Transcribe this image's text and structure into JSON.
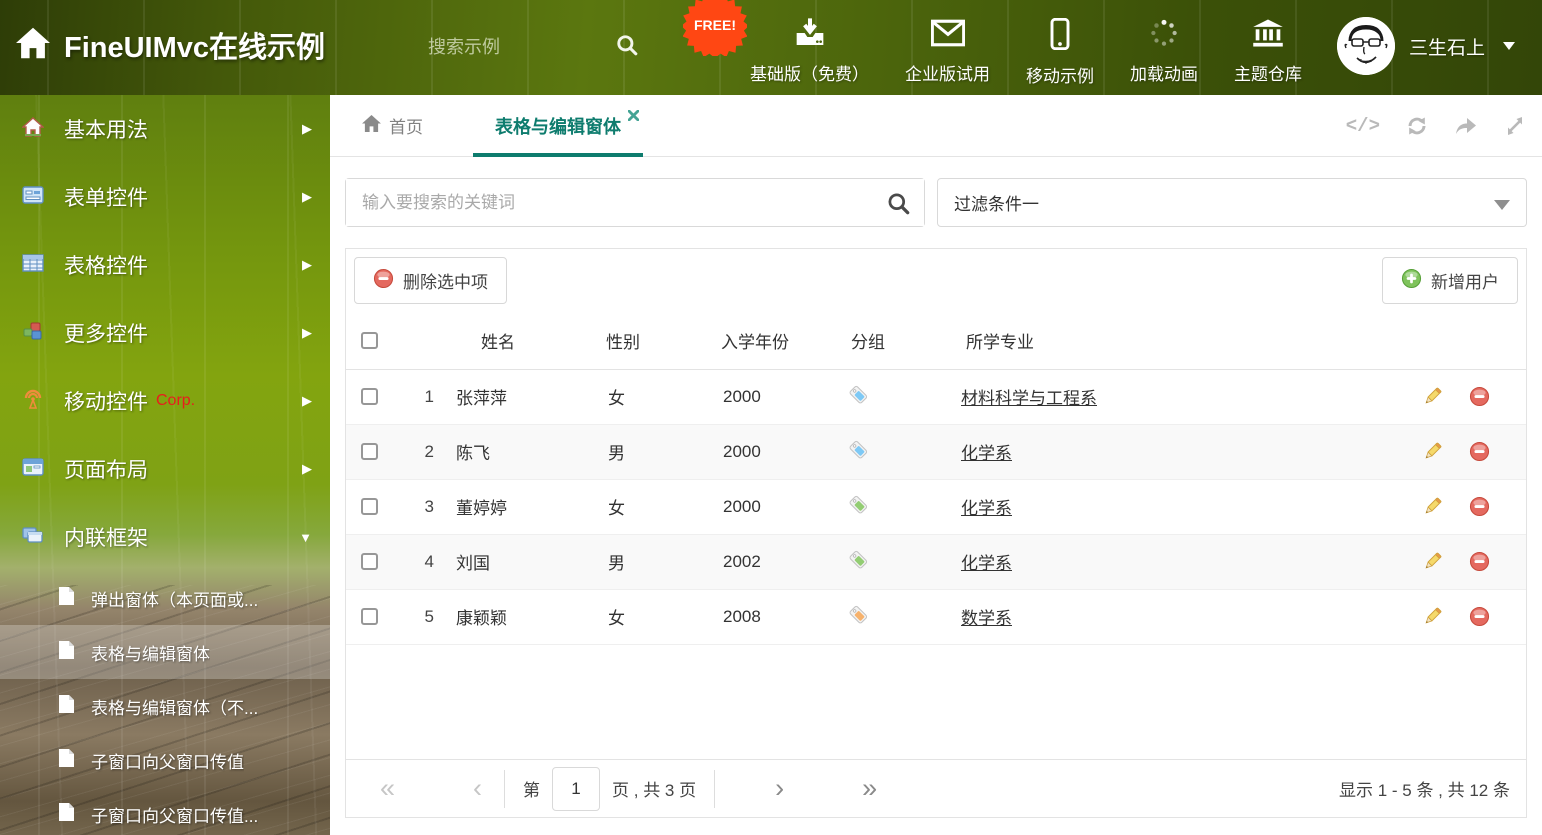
{
  "header": {
    "title": "FineUIMvc在线示例",
    "search_placeholder": "搜索示例",
    "free_badge": "FREE!",
    "nav": [
      {
        "label": "基础版（免费）",
        "icon": "download-icon"
      },
      {
        "label": "企业版试用",
        "icon": "envelope-icon"
      },
      {
        "label": "移动示例",
        "icon": "mobile-icon"
      },
      {
        "label": "加载动画",
        "icon": "spinner-icon"
      },
      {
        "label": "主题仓库",
        "icon": "bank-icon"
      }
    ],
    "user": {
      "name": "三生石上"
    }
  },
  "sidebar": {
    "items": [
      {
        "label": "基本用法"
      },
      {
        "label": "表单控件"
      },
      {
        "label": "表格控件"
      },
      {
        "label": "更多控件"
      },
      {
        "label": "移动控件",
        "badge": "Corp."
      },
      {
        "label": "页面布局"
      },
      {
        "label": "内联框架"
      }
    ],
    "subitems": [
      {
        "label": "弹出窗体（本页面或..."
      },
      {
        "label": "表格与编辑窗体"
      },
      {
        "label": "表格与编辑窗体（不..."
      },
      {
        "label": "子窗口向父窗口传值"
      },
      {
        "label": "子窗口向父窗口传值..."
      }
    ]
  },
  "tabs": {
    "home": "首页",
    "active": "表格与编辑窗体"
  },
  "filter": {
    "search_placeholder": "输入要搜索的关键词",
    "dropdown_value": "过滤条件一"
  },
  "toolbar": {
    "delete_label": "删除选中项",
    "add_label": "新增用户"
  },
  "table": {
    "columns": {
      "name": "姓名",
      "gender": "性别",
      "year": "入学年份",
      "group": "分组",
      "major": "所学专业"
    },
    "rows": [
      {
        "index": "1",
        "name": "张萍萍",
        "gender": "女",
        "year": "2000",
        "tag_color": "#7ec9f5",
        "major": "材料科学与工程系"
      },
      {
        "index": "2",
        "name": "陈飞",
        "gender": "男",
        "year": "2000",
        "tag_color": "#7ec9f5",
        "major": "化学系"
      },
      {
        "index": "3",
        "name": "董婷婷",
        "gender": "女",
        "year": "2000",
        "tag_color": "#93cd73",
        "major": "化学系"
      },
      {
        "index": "4",
        "name": "刘国",
        "gender": "男",
        "year": "2002",
        "tag_color": "#93cd73",
        "major": "化学系"
      },
      {
        "index": "5",
        "name": "康颖颖",
        "gender": "女",
        "year": "2008",
        "tag_color": "#f6b26d",
        "major": "数学系"
      }
    ]
  },
  "pagination": {
    "first": "«",
    "prev": "‹",
    "next": "›",
    "last": "»",
    "prefix": "第",
    "page": "1",
    "suffix": "页 , 共 3 页",
    "summary": "显示 1 - 5 条 , 共 12 条"
  },
  "colors": {
    "accent": "#0e7c6e",
    "free_badge_bg": "#ff4713",
    "corp_badge": "#e81d1d"
  }
}
